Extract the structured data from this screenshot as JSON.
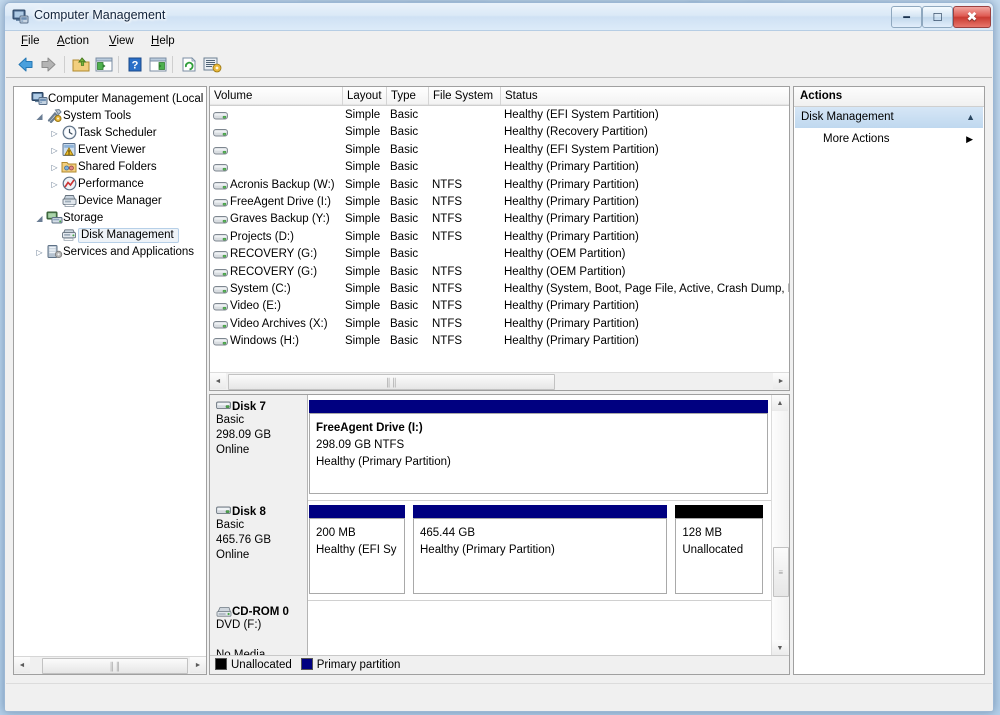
{
  "window": {
    "title": "Computer Management",
    "icon": "computer-management-icon",
    "buttons": {
      "minimize": "–",
      "maximize": "□",
      "close": "✕"
    }
  },
  "menubar": [
    {
      "name": "file",
      "label": "File",
      "accel": "F"
    },
    {
      "name": "action",
      "label": "Action",
      "accel": "A"
    },
    {
      "name": "view",
      "label": "View",
      "accel": "V"
    },
    {
      "name": "help",
      "label": "Help",
      "accel": "H"
    }
  ],
  "toolbar": [
    {
      "name": "back-button",
      "icon": "back-arrow-icon"
    },
    {
      "name": "forward-button",
      "icon": "forward-arrow-icon"
    },
    {
      "name": "up-one-level-button",
      "icon": "folder-up-icon"
    },
    {
      "name": "show-hide-tree-button",
      "icon": "console-tree-icon"
    },
    {
      "name": "help-button",
      "icon": "question-mark-icon"
    },
    {
      "name": "show-hide-action-pane-button",
      "icon": "action-pane-icon"
    },
    {
      "name": "refresh-button",
      "icon": "refresh-icon"
    },
    {
      "name": "properties-button",
      "icon": "properties-icon"
    }
  ],
  "tree": [
    {
      "label": "Computer Management (Local",
      "indent": 0,
      "expander": "",
      "icon": "computer-icon",
      "selected": false
    },
    {
      "label": "System Tools",
      "indent": 1,
      "expander": "◢",
      "icon": "tools-icon",
      "selected": false
    },
    {
      "label": "Task Scheduler",
      "indent": 2,
      "expander": "▷",
      "icon": "clock-icon",
      "selected": false
    },
    {
      "label": "Event Viewer",
      "indent": 2,
      "expander": "▷",
      "icon": "event-viewer-icon",
      "selected": false
    },
    {
      "label": "Shared Folders",
      "indent": 2,
      "expander": "▷",
      "icon": "shared-folders-icon",
      "selected": false
    },
    {
      "label": "Performance",
      "indent": 2,
      "expander": "▷",
      "icon": "performance-icon",
      "selected": false
    },
    {
      "label": "Device Manager",
      "indent": 2,
      "expander": "",
      "icon": "device-manager-icon",
      "selected": false
    },
    {
      "label": "Storage",
      "indent": 1,
      "expander": "◢",
      "icon": "storage-icon",
      "selected": false
    },
    {
      "label": "Disk Management",
      "indent": 2,
      "expander": "",
      "icon": "disk-management-icon",
      "selected": true
    },
    {
      "label": "Services and Applications",
      "indent": 1,
      "expander": "▷",
      "icon": "services-icon",
      "selected": false
    }
  ],
  "volume_list": {
    "columns": [
      {
        "name": "volume",
        "label": "Volume"
      },
      {
        "name": "layout",
        "label": "Layout"
      },
      {
        "name": "type",
        "label": "Type"
      },
      {
        "name": "file-system",
        "label": "File System"
      },
      {
        "name": "status",
        "label": "Status"
      }
    ],
    "rows": [
      {
        "volume": "",
        "layout": "Simple",
        "type": "Basic",
        "fs": "",
        "status": "Healthy (EFI System Partition)"
      },
      {
        "volume": "",
        "layout": "Simple",
        "type": "Basic",
        "fs": "",
        "status": "Healthy (Recovery Partition)"
      },
      {
        "volume": "",
        "layout": "Simple",
        "type": "Basic",
        "fs": "",
        "status": "Healthy (EFI System Partition)"
      },
      {
        "volume": "",
        "layout": "Simple",
        "type": "Basic",
        "fs": "",
        "status": "Healthy (Primary Partition)"
      },
      {
        "volume": "Acronis Backup (W:)",
        "layout": "Simple",
        "type": "Basic",
        "fs": "NTFS",
        "status": "Healthy (Primary Partition)"
      },
      {
        "volume": "FreeAgent Drive (I:)",
        "layout": "Simple",
        "type": "Basic",
        "fs": "NTFS",
        "status": "Healthy (Primary Partition)"
      },
      {
        "volume": "Graves Backup (Y:)",
        "layout": "Simple",
        "type": "Basic",
        "fs": "NTFS",
        "status": "Healthy (Primary Partition)"
      },
      {
        "volume": "Projects (D:)",
        "layout": "Simple",
        "type": "Basic",
        "fs": "NTFS",
        "status": "Healthy (Primary Partition)"
      },
      {
        "volume": "RECOVERY (G:)",
        "layout": "Simple",
        "type": "Basic",
        "fs": "",
        "status": "Healthy (OEM Partition)"
      },
      {
        "volume": "RECOVERY (G:)",
        "layout": "Simple",
        "type": "Basic",
        "fs": "NTFS",
        "status": "Healthy (OEM Partition)"
      },
      {
        "volume": "System (C:)",
        "layout": "Simple",
        "type": "Basic",
        "fs": "NTFS",
        "status": "Healthy (System, Boot, Page File, Active, Crash Dump, Pr"
      },
      {
        "volume": "Video (E:)",
        "layout": "Simple",
        "type": "Basic",
        "fs": "NTFS",
        "status": "Healthy (Primary Partition)"
      },
      {
        "volume": "Video Archives (X:)",
        "layout": "Simple",
        "type": "Basic",
        "fs": "NTFS",
        "status": "Healthy (Primary Partition)"
      },
      {
        "volume": "Windows (H:)",
        "layout": "Simple",
        "type": "Basic",
        "fs": "NTFS",
        "status": "Healthy (Primary Partition)"
      }
    ]
  },
  "disks": [
    {
      "name": "Disk 7",
      "icon": "hard-disk-icon",
      "type": "Basic",
      "size": "298.09 GB",
      "status": "Online",
      "partitions": [
        {
          "color": "#000080",
          "width_pct": 100,
          "lines": [
            "FreeAgent Drive  (I:)",
            "298.09 GB NTFS",
            "Healthy (Primary Partition)"
          ],
          "bold_first": true
        }
      ]
    },
    {
      "name": "Disk 8",
      "icon": "hard-disk-icon",
      "type": "Basic",
      "size": "465.76 GB",
      "status": "Online",
      "partitions": [
        {
          "color": "#000080",
          "width_pct": 21.6,
          "lines": [
            "",
            "200 MB",
            "Healthy (EFI Sy"
          ],
          "bold_first": true
        },
        {
          "color": "#000080",
          "width_pct": 55.8,
          "lines": [
            "",
            "465.44 GB",
            "Healthy (Primary Partition)"
          ],
          "bold_first": true
        },
        {
          "color": "#000000",
          "width_pct": 19.8,
          "lines": [
            "",
            "128 MB",
            "Unallocated"
          ],
          "bold_first": true
        }
      ]
    },
    {
      "name": "CD-ROM 0",
      "icon": "cdrom-icon",
      "type": "DVD (F:)",
      "size": "",
      "status": "No Media",
      "partitions": []
    }
  ],
  "legend": [
    {
      "label": "Unallocated",
      "color": "#000000"
    },
    {
      "label": "Primary partition",
      "color": "#000080"
    }
  ],
  "actions": {
    "title": "Actions",
    "group": {
      "label": "Disk Management",
      "chevron": "▲"
    },
    "items": [
      {
        "label": "More Actions",
        "arrow": "▶"
      }
    ]
  },
  "scrollbars": {
    "left_arrow": "◄",
    "right_arrow": "►",
    "up_arrow": "▲",
    "down_arrow": "▼",
    "grip_h": "‖‖",
    "grip_v": "≡"
  }
}
